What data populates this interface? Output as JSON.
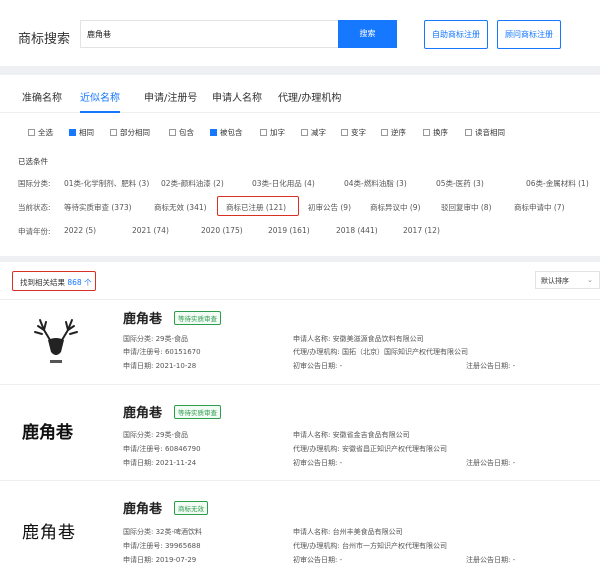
{
  "top": {
    "title": "商标搜索",
    "search_value": "鹿角巷",
    "search_button": "搜索",
    "auto_register_button": "自助商标注册",
    "consult_register_button": "顾问商标注册"
  },
  "tabs": [
    "准确名称",
    "近似名称",
    "申请/注册号",
    "申请人名称",
    "代理/办理机构"
  ],
  "active_tab": "近似名称",
  "checkboxes": [
    {
      "label": "全选",
      "checked": false
    },
    {
      "label": "相同",
      "checked": true
    },
    {
      "label": "部分相同",
      "checked": false
    },
    {
      "label": "包含",
      "checked": false
    },
    {
      "label": "被包含",
      "checked": true
    },
    {
      "label": "加字",
      "checked": false
    },
    {
      "label": "减字",
      "checked": false
    },
    {
      "label": "变字",
      "checked": false
    },
    {
      "label": "逆序",
      "checked": false
    },
    {
      "label": "换序",
      "checked": false
    },
    {
      "label": "读音相同",
      "checked": false
    }
  ],
  "filters": {
    "heading": "已选条件",
    "class_label": "国际分类:",
    "classes": [
      "01类-化学制剂、肥料 (3)",
      "02类-颜料油漆 (2)",
      "03类-日化用品 (4)",
      "04类-燃料油脂 (3)",
      "05类-医药 (3)",
      "06类-金属材料 (1)"
    ],
    "status_label": "当前状态:",
    "statuses": [
      "等待实质审查 (373)",
      "商标无效 (341)",
      "商标已注册 (121)",
      "初审公告 (9)",
      "商标异议中 (9)",
      "驳回复审中 (8)",
      "商标申请中 (7)"
    ],
    "year_label": "申请年份:",
    "years": [
      "2022 (5)",
      "2021 (74)",
      "2020 (175)",
      "2019 (161)",
      "2018 (441)",
      "2017 (12)"
    ]
  },
  "results": {
    "found_prefix": "找到相关结果",
    "found_count": "868",
    "found_suffix": "个",
    "sort_label": "默认排序",
    "items": [
      {
        "name": "鹿角巷",
        "badge": "等待实质审查",
        "class": "国际分类: 29类-食品",
        "reg_no": "申请/注册号: 60151670",
        "apply_date": "申请日期: 2021-10-28",
        "applicant": "申请人名称: 安徽美滋源食品饮料有限公司",
        "agent": "代理/办理机构: 国拓（北京）国际知识产权代理有限公司",
        "prelim": "初审公告日期: -",
        "reg_pub": "注册公告日期: -"
      },
      {
        "name": "鹿角巷",
        "badge": "等待实质审查",
        "logo_text": "鹿角巷",
        "class": "国际分类: 29类-食品",
        "reg_no": "申请/注册号: 60846790",
        "apply_date": "申请日期: 2021-11-24",
        "applicant": "申请人名称: 安徽省金吉食品有限公司",
        "agent": "代理/办理机构: 安徽省昌正知识产权代理有限公司",
        "prelim": "初审公告日期: -",
        "reg_pub": "注册公告日期: -"
      },
      {
        "name": "鹿角巷",
        "badge": "商标无效",
        "logo_text": "鹿角巷",
        "class": "国际分类: 32类-啤酒饮料",
        "reg_no": "申请/注册号: 39965688",
        "apply_date": "申请日期: 2019-07-29",
        "applicant": "申请人名称: 台州丰美食品有限公司",
        "agent": "代理/办理机构: 台州市一方知识产权代理有限公司",
        "prelim": "初审公告日期: -",
        "reg_pub": "注册公告日期: -"
      }
    ]
  },
  "colors": {
    "accent": "#1677ff",
    "highlight": "#d93025",
    "badge": "#2e9d4f"
  }
}
